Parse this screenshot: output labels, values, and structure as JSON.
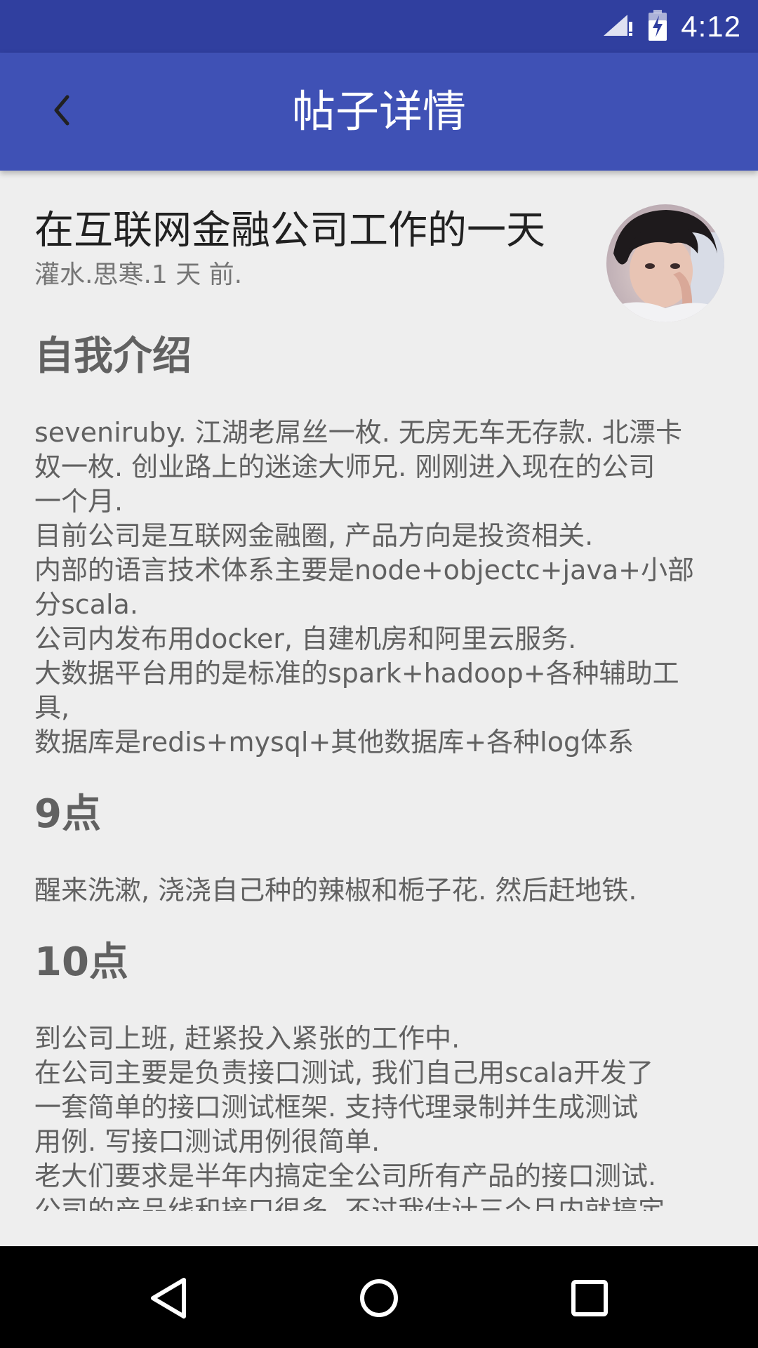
{
  "status_bar": {
    "time": "4:12",
    "icons": [
      "signal-icon",
      "battery-charging-icon"
    ]
  },
  "app_bar": {
    "title": "帖子详情",
    "back_icon": "chevron-left-icon"
  },
  "post": {
    "title": "在互联网金融公司工作的一天",
    "meta": "灌水.思寒.1 天 前.",
    "avatar": "user-avatar"
  },
  "article": {
    "sections": [
      {
        "heading": "自我介绍",
        "lines": [
          "seveniruby. 江湖老屌丝一枚. 无房无车无存款. 北漂卡",
          "奴一枚. 创业路上的迷途大师兄. 刚刚进入现在的公司",
          "一个月.",
          "目前公司是互联网金融圈, 产品方向是投资相关.",
          "内部的语言技术体系主要是node+objectc+java+小部",
          "分scala.",
          "公司内发布用docker, 自建机房和阿里云服务.",
          "大数据平台用的是标准的spark+hadoop+各种辅助工",
          "具,",
          "数据库是redis+mysql+其他数据库+各种log体系"
        ]
      },
      {
        "heading": "9点",
        "lines": [
          "醒来洗漱, 浇浇自己种的辣椒和栀子花. 然后赶地铁."
        ]
      },
      {
        "heading": "10点",
        "lines": [
          "到公司上班, 赶紧投入紧张的工作中.",
          "在公司主要是负责接口测试, 我们自己用scala开发了",
          "一套简单的接口测试框架. 支持代理录制并生成测试",
          "用例. 写接口测试用例很简单.",
          "老大们要求是半年内搞定全公司所有产品的接口测试.",
          "公司的产品线和接口很多. 不过我估计三个月内就搞定"
        ]
      }
    ]
  },
  "nav_bar": {
    "buttons": [
      "back-triangle-icon",
      "home-circle-icon",
      "recents-square-icon"
    ]
  },
  "colors": {
    "status_bar": "#303f9f",
    "app_bar": "#3f51b5",
    "background": "#eeeeee",
    "title_text": "#212121",
    "body_text": "#616161",
    "nav_bar": "#000000"
  }
}
